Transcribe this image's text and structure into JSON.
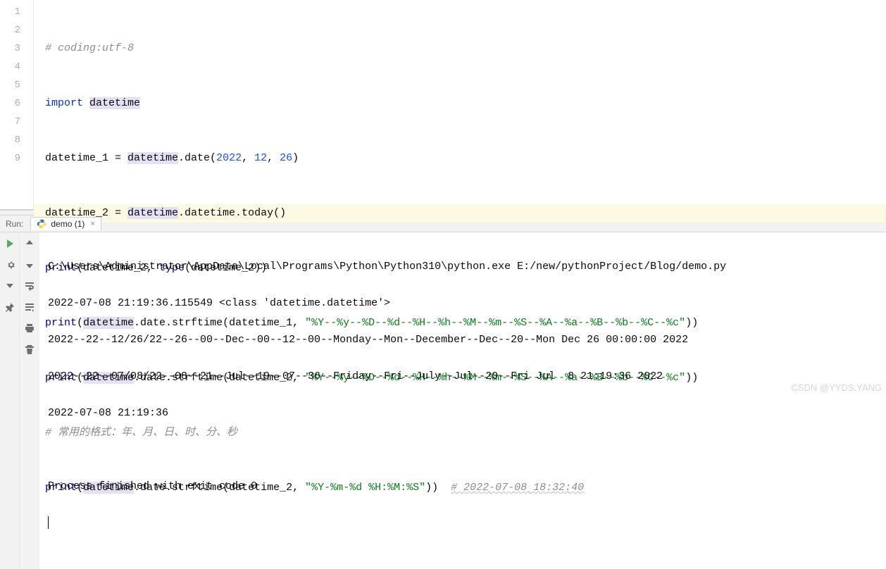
{
  "editor": {
    "gutter": [
      "1",
      "2",
      "3",
      "4",
      "5",
      "6",
      "7",
      "8",
      "9"
    ],
    "lines": {
      "l1_comment": "# coding:utf-8",
      "l2_import": "import",
      "l2_mod": "datetime",
      "l3_lhs": "datetime_1 = ",
      "l3_mod": "datetime",
      "l3_call": ".date(",
      "l3_y": "2022",
      "l3_m": "12",
      "l3_d": "26",
      "l3_close": ")",
      "l4_lhs": "datetime_2 = ",
      "l4_mod": "datetime",
      "l4_rest": ".datetime.today()",
      "l5_print": "print",
      "l5_args": "(datetime_2, ",
      "l5_type": "type",
      "l5_targs": "(datetime_2))",
      "l6_print": "print",
      "l6_pre": "(",
      "l6_dt": "datetime",
      "l6_call": ".date.strftime(datetime_1, ",
      "l6_str": "\"%Y--%y--%D--%d--%H--%h--%M--%m--%S--%A--%a--%B--%b--%C--%c\"",
      "l6_close": "))",
      "l7_print": "print",
      "l7_pre": "(",
      "l7_dt": "datetime",
      "l7_call": ".date.strftime(datetime_2, ",
      "l7_str": "\"%Y--%y--%D--%d--%H--%h--%M--%m--%S--%A--%a--%B--%b--%C--%c\"",
      "l7_close": "))",
      "l8_comment": "# 常用的格式：年、月、日、时、分、秒",
      "l9_print": "print",
      "l9_pre": "(",
      "l9_dt": "datetime",
      "l9_call": ".date.strftime(datetime_2, ",
      "l9_str": "\"%Y-%m-%d %H:%M:%S\"",
      "l9_close": "))  ",
      "l9_comment": "# 2022-07-08 18:32:40"
    }
  },
  "run": {
    "label": "Run:",
    "tab_name": "demo (1)",
    "output": {
      "l1": "C:\\Users\\Administrator\\AppData\\Local\\Programs\\Python\\Python310\\python.exe E:/new/pythonProject/Blog/demo.py",
      "l2": "2022-07-08 21:19:36.115549 <class 'datetime.datetime'>",
      "l3": "2022--22--12/26/22--26--00--Dec--00--12--00--Monday--Mon--December--Dec--20--Mon Dec 26 00:00:00 2022",
      "l4": "2022--22--07/08/22--08--21--Jul--19--07--36--Friday--Fri--July--Jul--20--Fri Jul  8 21:19:36 2022",
      "l5": "2022-07-08 21:19:36",
      "l6": "",
      "l7": "Process finished with exit code 0"
    }
  },
  "watermark": {
    "w1": "CSDN @YYDS.YANG",
    "w2": ""
  }
}
